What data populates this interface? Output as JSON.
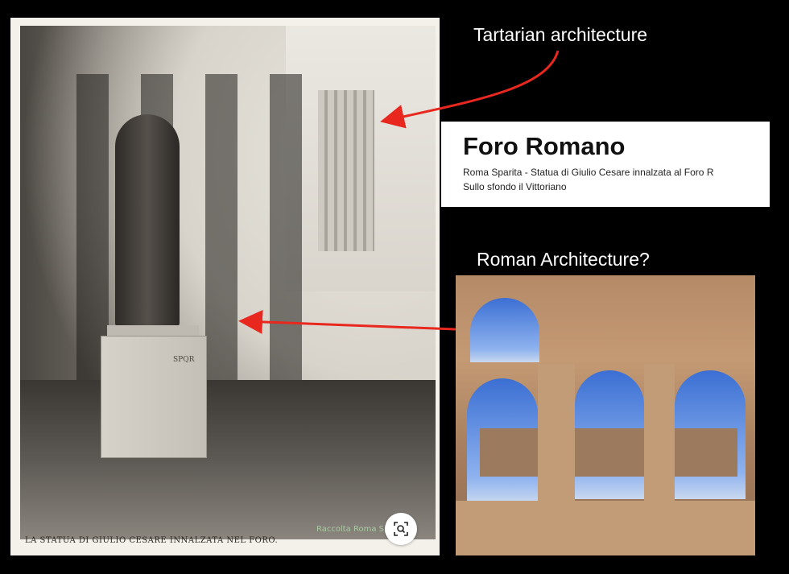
{
  "left_photo": {
    "caption": "LA STATUA DI GIULIO CESARE INNALZATA NEL FORO.",
    "watermark": "Raccolta Roma Sparita",
    "pedestal_text": "SPQR"
  },
  "labels": {
    "tartarian": "Tartarian architecture",
    "roman": "Roman Architecture?"
  },
  "foro_card": {
    "title": "Foro Romano",
    "line1": "Roma Sparita - Statua di Giulio Cesare innalzata al Foro R",
    "line2": "Sullo sfondo il Vittoriano"
  },
  "colors": {
    "background": "#000000",
    "arrow": "#e8281e",
    "label_text": "#ffffff"
  },
  "icons": {
    "zoom": "zoom-search-icon"
  }
}
